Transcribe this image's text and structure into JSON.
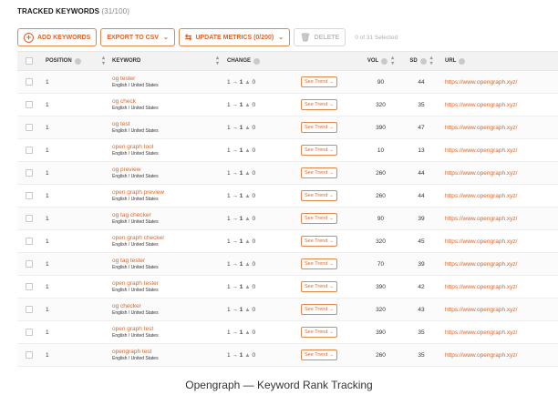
{
  "header": {
    "title": "TRACKED KEYWORDS",
    "count": "(31/100)"
  },
  "toolbar": {
    "add_keywords": "ADD KEYWORDS",
    "export_csv": "EXPORT TO CSV",
    "update_metrics": "UPDATE METRICS (0/200)",
    "delete": "DELETE",
    "selected_info": "0 of 31 Selected"
  },
  "table": {
    "columns": {
      "position": "POSITION",
      "keyword": "KEYWORD",
      "change": "CHANGE",
      "vol": "VOL",
      "sd": "SD",
      "url": "URL"
    },
    "trend_label": "See Trend",
    "rows": [
      {
        "position": "1",
        "keyword": "og tester",
        "location": "English / United States",
        "change_from": "1",
        "change_to": "1",
        "change_delta": "0",
        "vol": "90",
        "sd": "44",
        "url": "https://www.opengraph.xyz/"
      },
      {
        "position": "1",
        "keyword": "og check",
        "location": "English / United States",
        "change_from": "1",
        "change_to": "1",
        "change_delta": "0",
        "vol": "320",
        "sd": "35",
        "url": "https://www.opengraph.xyz/"
      },
      {
        "position": "1",
        "keyword": "og test",
        "location": "English / United States",
        "change_from": "1",
        "change_to": "1",
        "change_delta": "0",
        "vol": "390",
        "sd": "47",
        "url": "https://www.opengraph.xyz/"
      },
      {
        "position": "1",
        "keyword": "open graph tool",
        "location": "English / United States",
        "change_from": "1",
        "change_to": "1",
        "change_delta": "0",
        "vol": "10",
        "sd": "13",
        "url": "https://www.opengraph.xyz/"
      },
      {
        "position": "1",
        "keyword": "og preview",
        "location": "English / United States",
        "change_from": "1",
        "change_to": "1",
        "change_delta": "0",
        "vol": "260",
        "sd": "44",
        "url": "https://www.opengraph.xyz/"
      },
      {
        "position": "1",
        "keyword": "open graph preview",
        "location": "English / United States",
        "change_from": "1",
        "change_to": "1",
        "change_delta": "0",
        "vol": "260",
        "sd": "44",
        "url": "https://www.opengraph.xyz/"
      },
      {
        "position": "1",
        "keyword": "og tag checker",
        "location": "English / United States",
        "change_from": "1",
        "change_to": "1",
        "change_delta": "0",
        "vol": "90",
        "sd": "39",
        "url": "https://www.opengraph.xyz/"
      },
      {
        "position": "1",
        "keyword": "open graph checker",
        "location": "English / United States",
        "change_from": "1",
        "change_to": "1",
        "change_delta": "0",
        "vol": "320",
        "sd": "45",
        "url": "https://www.opengraph.xyz/"
      },
      {
        "position": "1",
        "keyword": "og tag tester",
        "location": "English / United States",
        "change_from": "1",
        "change_to": "1",
        "change_delta": "0",
        "vol": "70",
        "sd": "39",
        "url": "https://www.opengraph.xyz/"
      },
      {
        "position": "1",
        "keyword": "open graph tester",
        "location": "English / United States",
        "change_from": "1",
        "change_to": "1",
        "change_delta": "0",
        "vol": "390",
        "sd": "42",
        "url": "https://www.opengraph.xyz/"
      },
      {
        "position": "1",
        "keyword": "og checker",
        "location": "English / United States",
        "change_from": "1",
        "change_to": "1",
        "change_delta": "0",
        "vol": "320",
        "sd": "43",
        "url": "https://www.opengraph.xyz/"
      },
      {
        "position": "1",
        "keyword": "open graph test",
        "location": "English / United States",
        "change_from": "1",
        "change_to": "1",
        "change_delta": "0",
        "vol": "390",
        "sd": "35",
        "url": "https://www.opengraph.xyz/"
      },
      {
        "position": "1",
        "keyword": "opengraph test",
        "location": "English / United States",
        "change_from": "1",
        "change_to": "1",
        "change_delta": "0",
        "vol": "260",
        "sd": "35",
        "url": "https://www.opengraph.xyz/"
      }
    ]
  },
  "caption": "Opengraph — Keyword Rank Tracking",
  "colors": {
    "accent": "#d9662a",
    "header_bg": "#f2f2f2",
    "border": "#e0874d"
  },
  "icons": {
    "add": "plus-circle-icon",
    "sort": "sort-arrows-icon",
    "info": "info-icon",
    "refresh": "refresh-icon",
    "trash": "trash-icon",
    "chevron": "chevron-down-icon"
  }
}
